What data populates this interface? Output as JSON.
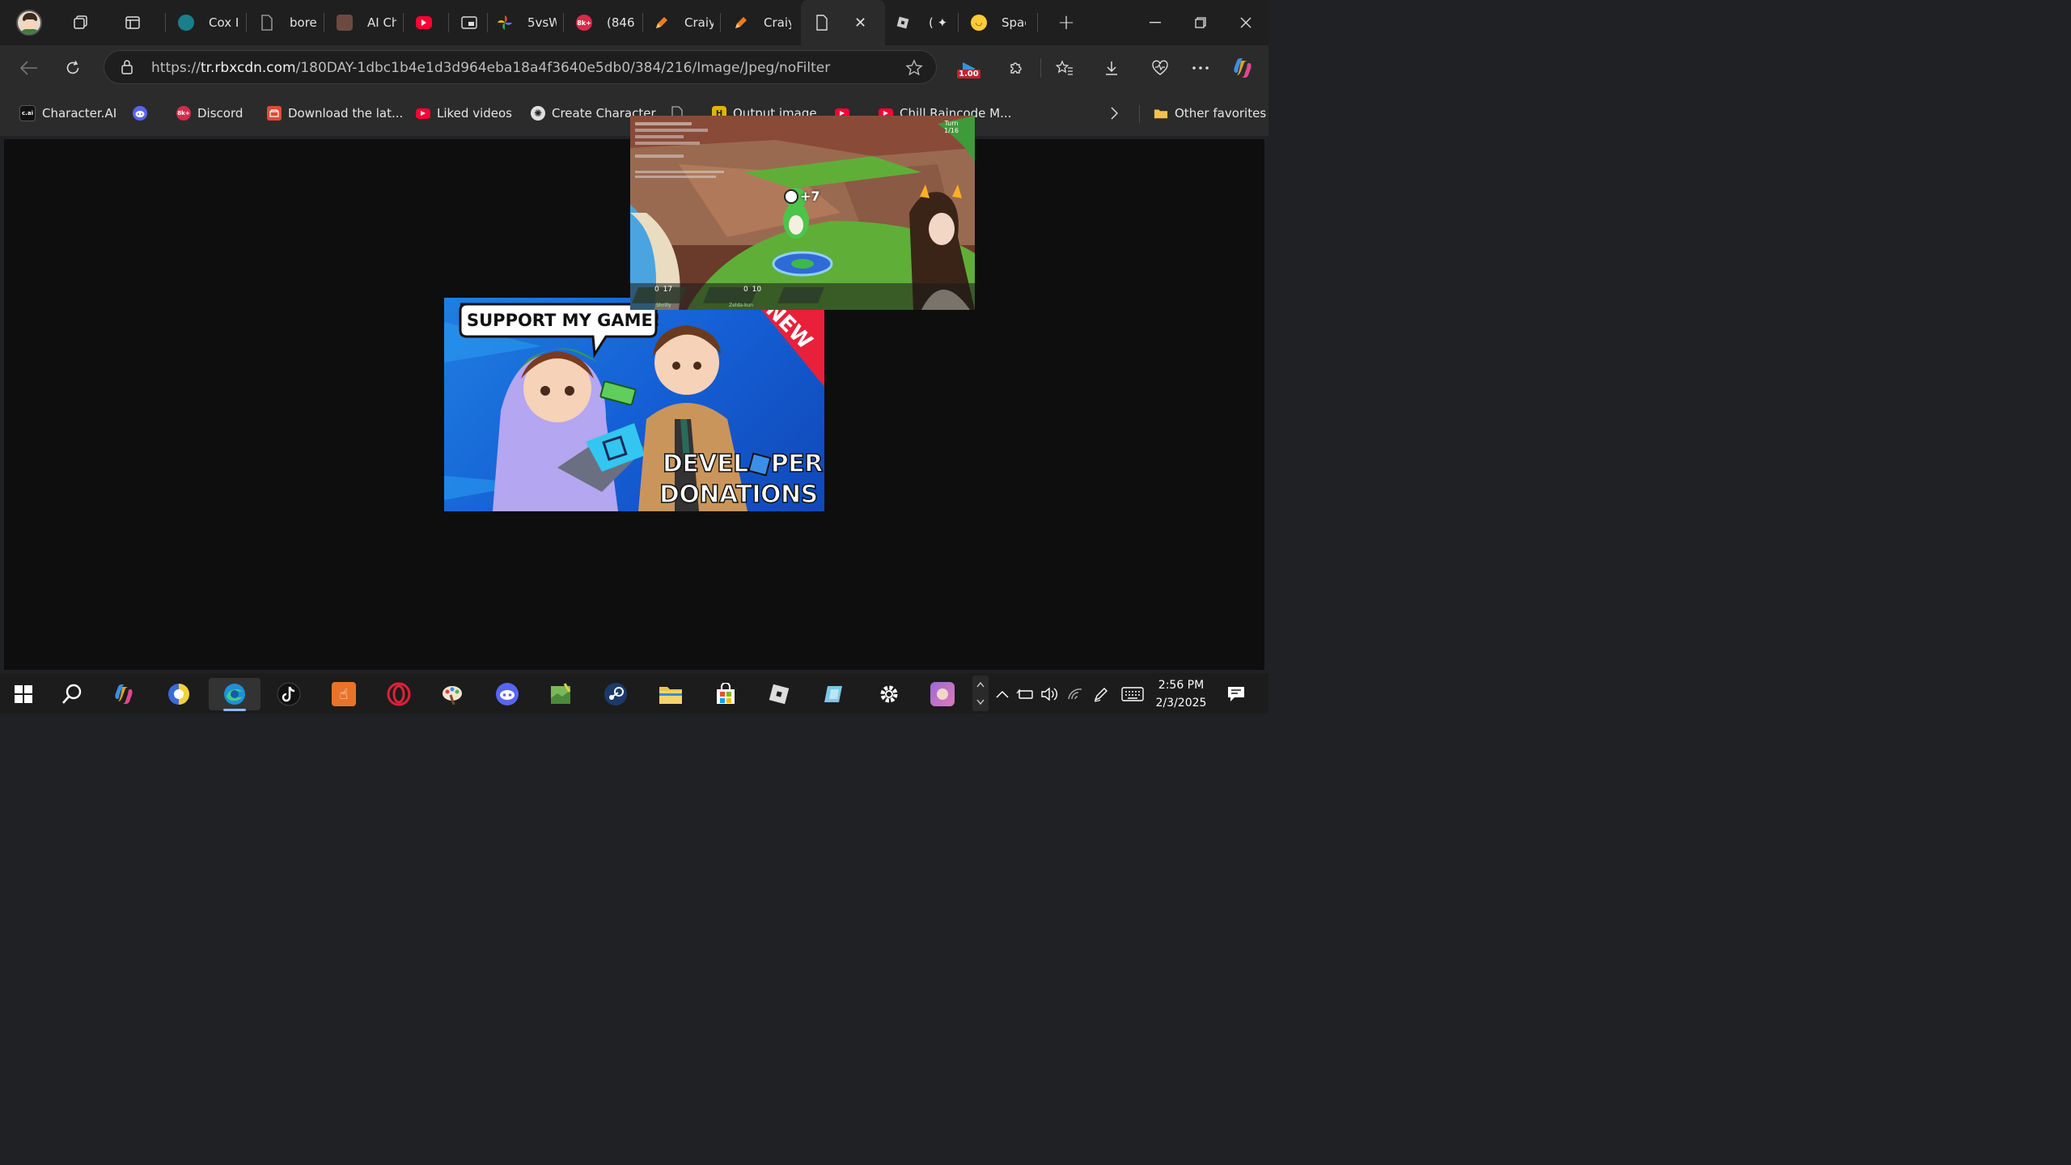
{
  "tabs": [
    {
      "label": "Cox I",
      "favicon": "cox-icon",
      "color": "#1a7f8c"
    },
    {
      "label": "bore",
      "favicon": "page-icon",
      "color": "#555"
    },
    {
      "label": "AI Ch",
      "favicon": "ai-avatar-icon",
      "color": "#6b4a42"
    },
    {
      "label": "",
      "favicon": "youtube-icon",
      "color": "#ff0033"
    },
    {
      "label": "",
      "favicon": "picture-in-picture-icon",
      "color": "#444"
    },
    {
      "label": "5vsW",
      "favicon": "pinwheel-icon",
      "color": "#34a853"
    },
    {
      "label": "(846",
      "favicon": "roblox-badge-icon",
      "color": "#d62b4a"
    },
    {
      "label": "Craiy",
      "favicon": "pencil-icon",
      "color": "#f07c1a"
    },
    {
      "label": "Craiy",
      "favicon": "pencil-icon",
      "color": "#f07c1a"
    },
    {
      "label": "",
      "favicon": "page-icon",
      "color": "#555",
      "active": true
    },
    {
      "label": "( ✦ )",
      "favicon": "roblox-icon",
      "color": "#bbb"
    },
    {
      "label": "Spac",
      "favicon": "hugging-face-icon",
      "color": "#ffcc33"
    }
  ],
  "address": {
    "url_prefix": "https://",
    "url_host": "tr.rbxcdn.com",
    "url_path": "/180DAY-1dbc1b4e1d3d964eba18a4f3640e5db0/384/216/Image/Jpeg/noFilter"
  },
  "extension_badge": "1.00",
  "bookmarks": [
    {
      "label": "Character.AI",
      "favicon": "character-ai-icon",
      "color": "#111"
    },
    {
      "label": "",
      "favicon": "discord-icon",
      "color": "#5865f2"
    },
    {
      "label": "Discord",
      "favicon": "roblox-badge-icon",
      "color": "#d62b4a"
    },
    {
      "label": "Download the lat...",
      "favicon": "store-icon",
      "color": "#e04a3a"
    },
    {
      "label": "Liked videos",
      "favicon": "youtube-icon",
      "color": "#ff0033"
    },
    {
      "label": "Create Character",
      "favicon": "openai-icon",
      "color": "#ddd"
    },
    {
      "label": "",
      "favicon": "page-icon",
      "color": "#777"
    },
    {
      "label": "Output image",
      "favicon": "h-icon",
      "color": "#e2b400"
    },
    {
      "label": "",
      "favicon": "youtube-icon",
      "color": "#ff0033"
    },
    {
      "label": "Chill Raincode M...",
      "favicon": "youtube-icon",
      "color": "#ff0033"
    }
  ],
  "other_favorites": "Other favorites",
  "thumbnail": {
    "speech_bubble": "SUPPORT MY GAME!",
    "banner": "NEW",
    "caption_line1": "DEVEL",
    "caption_line1b": "PER",
    "caption_line2": "DONATIONS"
  },
  "game_overlay": {
    "score_popup": "+7",
    "turn_label": "Turn",
    "turn_value": "1/16",
    "player_names": [
      "Shrilly",
      "Zelda-kun"
    ],
    "hud_values": [
      "0",
      "17",
      "0",
      "10"
    ]
  },
  "clock": {
    "time": "2:56 PM",
    "date": "2/3/2025"
  },
  "taskbar_icons": [
    "windows-start-icon",
    "search-icon",
    "copilot-icon",
    "app-icon",
    "edge-icon",
    "tiktok-icon",
    "hand-app-icon",
    "opera-icon",
    "paint-app-icon",
    "discord-icon",
    "game-app-icon",
    "steam-icon",
    "file-explorer-icon",
    "microsoft-store-icon",
    "roblox-icon",
    "roblox-studio-icon",
    "settings-icon",
    "avatar-app-icon"
  ]
}
